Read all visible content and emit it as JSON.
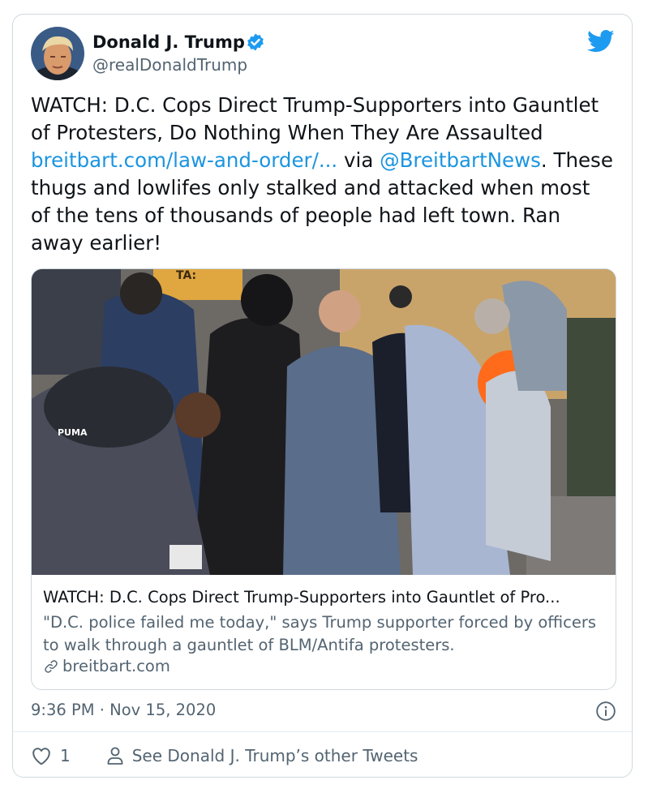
{
  "user": {
    "name": "Donald J. Trump",
    "handle": "@realDonaldTrump"
  },
  "tweet": {
    "text_before_link": "WATCH: D.C. Cops Direct Trump-Supporters into Gauntlet of Protesters, Do Nothing When They Are Assaulted ",
    "link_text": "breitbart.com/law-and-order/...",
    "text_via": " via ",
    "mention": "@BreitbartNews",
    "text_after": ". These thugs and lowlifes only stalked and attacked when most of the tens of thousands of people had left town. Ran away earlier!"
  },
  "link_card": {
    "title": "WATCH: D.C. Cops Direct Trump-Supporters into Gauntlet of Pro...",
    "description": "\"D.C. police failed me today,\" says Trump supporter forced by officers to walk through a gauntlet of BLM/Antifa protesters.",
    "domain": "breitbart.com",
    "sign_text": "TA:",
    "cap_text": "PUMA"
  },
  "meta": {
    "timestamp": "9:36 PM · Nov 15, 2020",
    "like_count": "1",
    "see_more_label": "See Donald J. Trump’s other Tweets"
  },
  "icons": {
    "bird": "twitter-bird-icon",
    "verified": "verified-badge-icon",
    "info": "info-icon",
    "heart": "heart-icon",
    "person": "person-icon",
    "link": "link-icon"
  },
  "colors": {
    "link": "#1b95e0",
    "text": "#0f1419",
    "secondary": "#536471",
    "border": "#cfd9de"
  }
}
